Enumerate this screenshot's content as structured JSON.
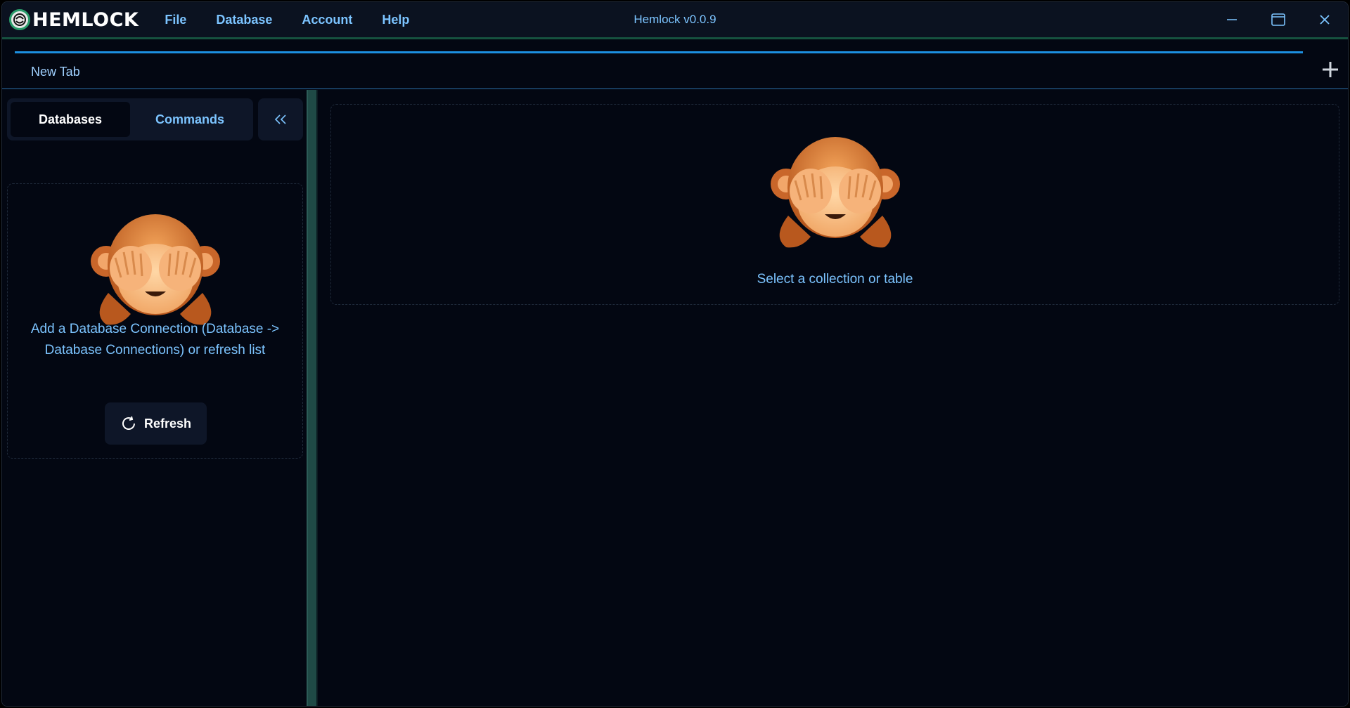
{
  "app": {
    "logo_text": "HEMLOCK",
    "window_title": "Hemlock v0.0.9"
  },
  "menu": {
    "items": [
      "File",
      "Database",
      "Account",
      "Help"
    ]
  },
  "tabs": {
    "items": [
      {
        "label": "New Tab"
      }
    ]
  },
  "sidebar": {
    "segments": [
      "Databases",
      "Commands"
    ],
    "active_segment": "Databases",
    "collapse_label": "<<",
    "empty_message": "Add a Database Connection (Database -> Database Connections) or refresh list",
    "refresh_label": "Refresh"
  },
  "main": {
    "empty_message": "Select a collection or table"
  },
  "icons": {
    "logo": "hemlock-logo-icon",
    "minimize": "minimize-icon",
    "maximize": "maximize-icon",
    "close": "close-icon",
    "add_tab": "plus-icon",
    "refresh": "refresh-icon",
    "illustration": "see-no-evil-monkey-icon"
  },
  "colors": {
    "accent": "#7cc4ff",
    "title_border": "#16523f",
    "tab_progress": "#1c8fe0",
    "background": "#030712",
    "surface": "#0e1628"
  }
}
